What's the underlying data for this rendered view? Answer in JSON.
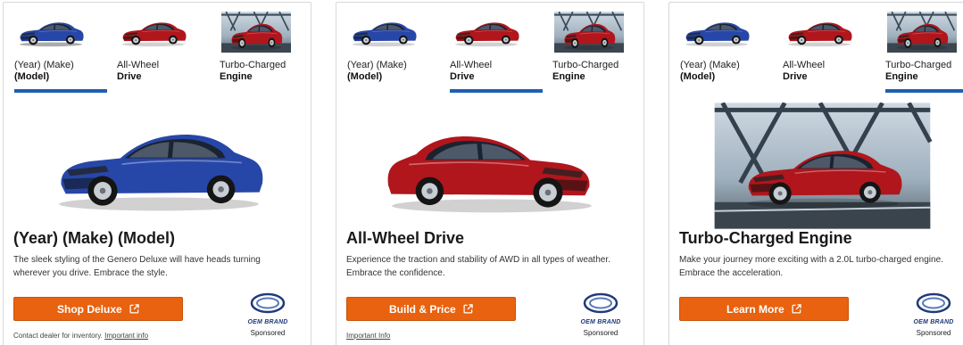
{
  "tab_labels": {
    "model": {
      "line1": "(Year) (Make)",
      "line2": "(Model)"
    },
    "awd": {
      "line1": "All-Wheel",
      "line2": "Drive"
    },
    "turbo": {
      "line1": "Turbo-Charged",
      "line2": "Engine"
    }
  },
  "cards": [
    {
      "active_tab": "model",
      "title": "(Year) (Make) (Model)",
      "description": "The sleek styling of the Genero Deluxe will have heads turning wherever you drive. Embrace the style.",
      "cta_label": "Shop Deluxe",
      "footer_text": "Contact dealer for inventory.",
      "footer_link": "Important info",
      "brand": "OEM BRAND",
      "sponsored": "Sponsored"
    },
    {
      "active_tab": "awd",
      "title": "All-Wheel Drive",
      "description": "Experience the traction and stability of AWD in all types of weather. Embrace the confidence.",
      "cta_label": "Build & Price",
      "footer_text": "",
      "footer_link": "Important Info",
      "brand": "OEM BRAND",
      "sponsored": "Sponsored"
    },
    {
      "active_tab": "turbo",
      "title": "Turbo-Charged Engine",
      "description": "Make your journey more exciting with a 2.0L turbo-charged engine. Embrace the acceleration.",
      "cta_label": "Learn More",
      "footer_text": "",
      "footer_link": "",
      "brand": "OEM BRAND",
      "sponsored": "Sponsored"
    }
  ],
  "colors": {
    "accent_blue": "#1f5fb4",
    "cta_orange": "#e8620f",
    "car_blue": "#2747a8",
    "car_red": "#b0161c"
  },
  "icons": {
    "external_link": "external-link-icon",
    "brand_logo": "oem-brand-logo-icon"
  }
}
